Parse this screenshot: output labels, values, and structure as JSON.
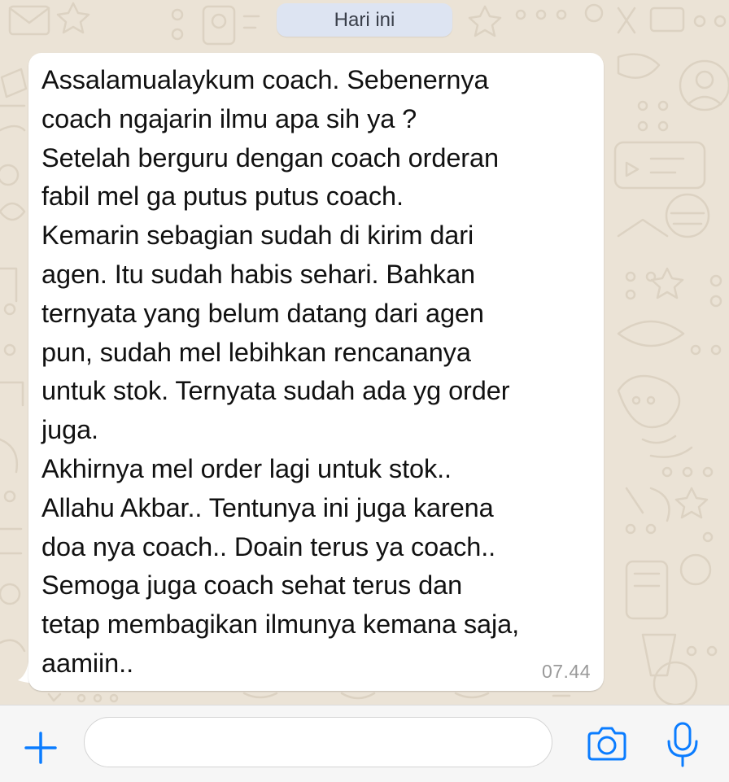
{
  "chat": {
    "date_separator": "Hari ini",
    "message": {
      "lines": [
        "Assalamualaykum coach. Sebenernya",
        "coach ngajarin ilmu apa sih ya ?",
        "Setelah berguru dengan coach orderan",
        "fabil mel ga putus putus coach.",
        "Kemarin sebagian sudah di kirim dari",
        "agen. Itu sudah habis sehari. Bahkan",
        "ternyata yang belum datang dari agen",
        "pun, sudah mel lebihkan rencananya",
        "untuk stok. Ternyata sudah ada yg order",
        "juga.",
        "Akhirnya mel order lagi untuk stok..",
        "Allahu Akbar.. Tentunya ini juga karena",
        "doa nya coach.. Doain terus ya coach..",
        "Semoga juga coach sehat terus dan",
        "tetap membagikan ilmunya kemana saja,",
        "aamiin.."
      ],
      "time": "07.44"
    }
  },
  "input_bar": {
    "plus_icon": "plus-icon",
    "message_value": "",
    "camera_icon": "camera-icon",
    "mic_icon": "microphone-icon"
  },
  "colors": {
    "accent": "#0a7cff",
    "wallpaper": "#ebe3d6",
    "doodle": "#ddd3c4",
    "bubble": "#ffffff",
    "date_pill": "#dde4f2",
    "timestamp": "#9a9a9a"
  }
}
